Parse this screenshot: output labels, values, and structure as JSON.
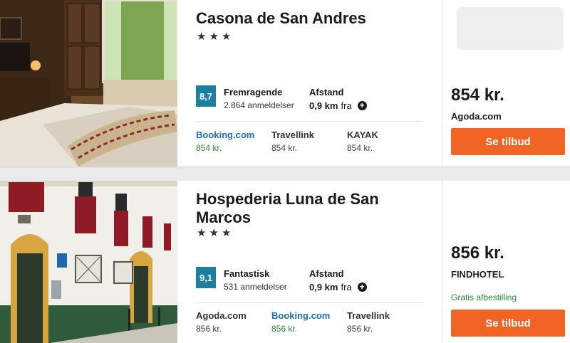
{
  "hotels": [
    {
      "name": "Casona de San Andres",
      "stars": "★★★",
      "score": "8,7",
      "rating_label": "Fremragende",
      "reviews": "2.864 anmeldelser",
      "distance_label": "Afstand",
      "distance_value": "0,9 km",
      "distance_suffix": "fra",
      "providers": [
        {
          "name": "Booking.com",
          "price": "854 kr."
        },
        {
          "name": "Travellink",
          "price": "854 kr."
        },
        {
          "name": "KAYAK",
          "price": "854 kr."
        }
      ],
      "best_price": "854 kr.",
      "best_source": "Agoda.com",
      "offer_button": "Se tilbud",
      "photo_icon": "hotel-room-photo"
    },
    {
      "name": "Hospederia Luna de San Marcos",
      "stars": "★★★",
      "score": "9,1",
      "rating_label": "Fantastisk",
      "reviews": "531 anmeldelser",
      "distance_label": "Afstand",
      "distance_value": "0,9 km",
      "distance_suffix": "fra",
      "providers": [
        {
          "name": "Agoda.com",
          "price": "856 kr."
        },
        {
          "name": "Booking.com",
          "price": "856 kr."
        },
        {
          "name": "Travellink",
          "price": "856 kr."
        }
      ],
      "best_price": "856 kr.",
      "best_source": "FINDHOTEL",
      "cancellation": "Gratis afbestilling",
      "offer_button": "Se tilbud",
      "photo_icon": "hotel-facade-photo"
    }
  ],
  "colors": {
    "score_badge": "#1a7fa1",
    "offer_button": "#f26424",
    "link_blue": "#1f6fb5",
    "green": "#2e8a3c"
  }
}
